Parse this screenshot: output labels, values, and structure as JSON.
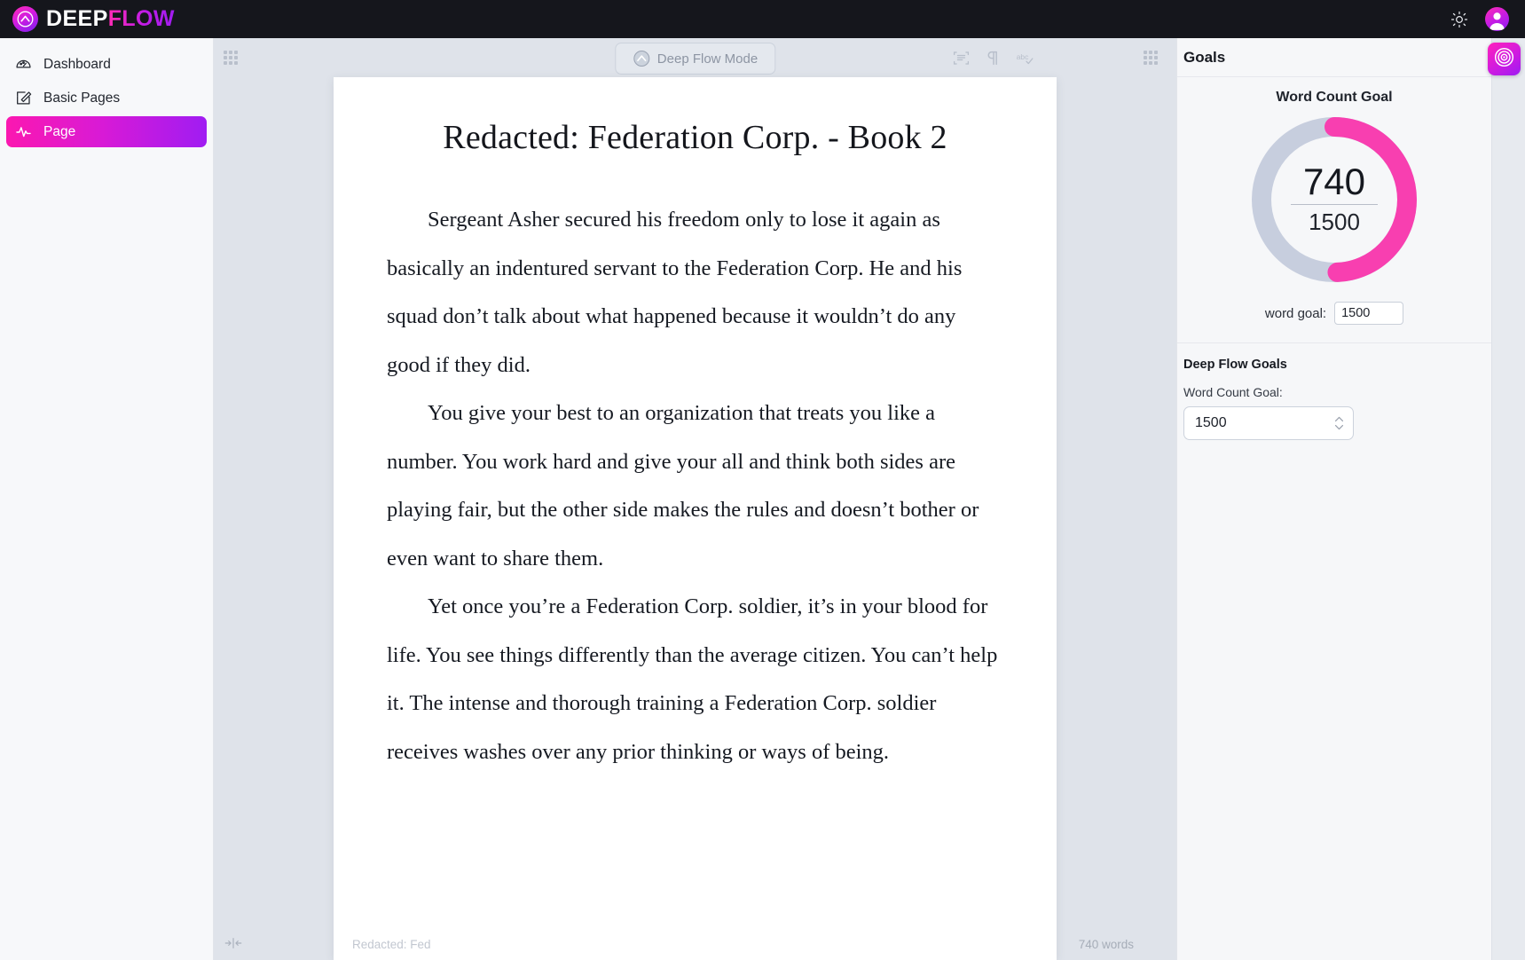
{
  "brand": {
    "deep": "DEEP",
    "flow": "FLOW",
    "mark_icon": "chevron-up-logo-icon"
  },
  "topbar": {
    "theme_toggle_icon": "sun-icon",
    "avatar_icon": "user-avatar-icon"
  },
  "sidebar": {
    "items": [
      {
        "label": "Dashboard",
        "icon": "gauge-icon",
        "active": false
      },
      {
        "label": "Basic Pages",
        "icon": "pencil-square-icon",
        "active": false
      },
      {
        "label": "Page",
        "icon": "activity-pulse-icon",
        "active": true
      }
    ]
  },
  "toolbar": {
    "left_handle_icon": "grid-dots-handle-icon",
    "right_handle_icon": "grid-dots-handle-icon",
    "flow_mode_label": "Deep Flow Mode",
    "flow_mode_icon": "deepflow-logo-icon",
    "tools": [
      {
        "name": "document-scan-icon",
        "title": "Document"
      },
      {
        "name": "pilcrow-icon",
        "title": "Paragraph marks"
      },
      {
        "name": "spellcheck-abc-icon",
        "title": "Spell check"
      }
    ]
  },
  "document": {
    "title": "Redacted: Federation Corp. - Book 2",
    "paragraphs": [
      "Sergeant Asher secured his freedom only to lose it again as basically an indentured servant to the Federation Corp. He and his squad don’t talk about what happened because it wouldn’t do any good if they did.",
      "You give your best to an organization that treats you like a number. You work hard and give your all and think both sides are playing fair, but the other side makes the rules and doesn’t bother or even want to share them.",
      "Yet once you’re a Federation Corp. soldier, it’s in your blood for life. You see things differently than the average citizen. You can’t help it. The intense and thorough training a Federation Corp. soldier receives washes over any prior thinking or ways of being."
    ]
  },
  "footer": {
    "title": "Redacted: Fed",
    "word_count": "740 words",
    "collapse_icon": "collapse-sidebar-icon"
  },
  "goals": {
    "panel_title": "Goals",
    "card_title": "Word Count Goal",
    "current": "740",
    "goal": "1500",
    "inline_label": "word goal:",
    "inline_value": "1500",
    "progress_percent": 49.3,
    "ring_color": "#f83fb0",
    "ring_track_color": "#c7cede",
    "section_title": "Deep Flow Goals",
    "field_label": "Word Count Goal:",
    "field_value": "1500",
    "spinner_icon": "stepper-updown-icon",
    "toggle_icon": "target-rings-icon"
  }
}
